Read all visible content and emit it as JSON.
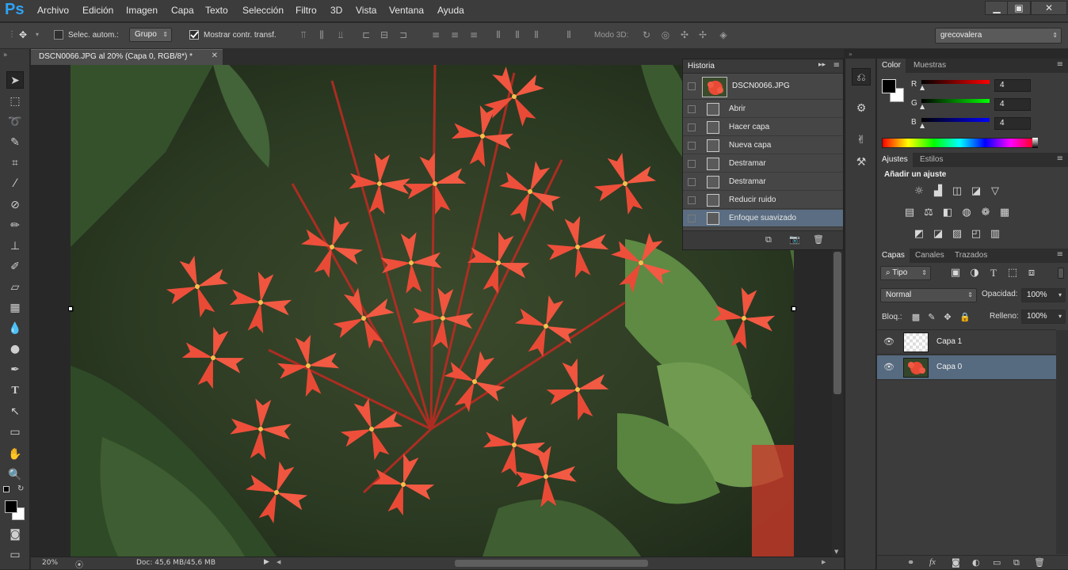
{
  "app": {
    "logo": "Ps",
    "accent": "#2fa3f5"
  },
  "menubar": {
    "items": [
      "Archivo",
      "Edición",
      "Imagen",
      "Capa",
      "Texto",
      "Selección",
      "Filtro",
      "3D",
      "Vista",
      "Ventana",
      "Ayuda"
    ],
    "window_controls": {
      "minimize": "▁",
      "restore": "▣",
      "close": "✕"
    }
  },
  "options": {
    "auto_select_label": "Selec. autom.:",
    "auto_select_checked": false,
    "auto_select_target": "Grupo",
    "show_transform_label": "Mostrar contr. transf.",
    "show_transform_checked": true,
    "mode3d_label": "Modo 3D:",
    "workspace": "grecovalera"
  },
  "document": {
    "tab_title": "DSCN0066.JPG al 20% (Capa 0, RGB/8*) *",
    "zoom": "20%",
    "doc_info": "Doc: 45,6 MB/45,6 MB"
  },
  "history": {
    "title": "Historia",
    "snapshot": "DSCN0066.JPG",
    "items": [
      "Abrir",
      "Hacer capa",
      "Nueva capa",
      "Destramar",
      "Destramar",
      "Reducir ruido",
      "Enfoque suavizado"
    ],
    "selected_index": 6
  },
  "color_panel": {
    "tabs": [
      "Color",
      "Muestras"
    ],
    "r_label": "R",
    "g_label": "G",
    "b_label": "B",
    "r": "4",
    "g": "4",
    "b": "4"
  },
  "adjustments": {
    "tabs": [
      "Ajustes",
      "Estilos"
    ],
    "heading": "Añadir un ajuste"
  },
  "layers_panel": {
    "tabs": [
      "Capas",
      "Canales",
      "Trazados"
    ],
    "filter_kind": "Tipo",
    "blend_mode": "Normal",
    "opacity_label": "Opacidad:",
    "opacity": "100%",
    "lock_label": "Bloq.:",
    "fill_label": "Relleno:",
    "fill": "100%",
    "layers": [
      {
        "name": "Capa 1",
        "visible": true,
        "selected": false
      },
      {
        "name": "Capa 0",
        "visible": true,
        "selected": true
      }
    ]
  }
}
